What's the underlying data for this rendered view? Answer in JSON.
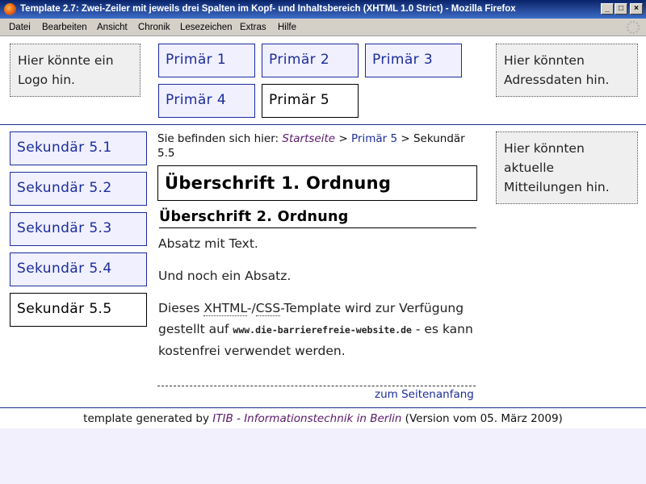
{
  "window": {
    "title": "Template 2.7: Zwei-Zeiler mit jeweils drei Spalten im Kopf- und Inhaltsbereich (XHTML 1.0 Strict) - Mozilla Firefox",
    "controls": {
      "minimize": "_",
      "maximize": "□",
      "close": "×"
    }
  },
  "menu": {
    "items": [
      {
        "label": "Datei"
      },
      {
        "label": "Bearbeiten"
      },
      {
        "label": "Ansicht"
      },
      {
        "label": "Chronik"
      },
      {
        "label": "Lesezeichen"
      },
      {
        "label": "Extras"
      },
      {
        "label": "Hilfe"
      }
    ]
  },
  "header": {
    "logo_text": "Hier könnte ein Logo hin.",
    "address_text": "Hier könnten Adressdaten hin.",
    "primary_nav": [
      {
        "label": "Primär 1"
      },
      {
        "label": "Primär 2"
      },
      {
        "label": "Primär 3"
      },
      {
        "label": "Primär 4"
      },
      {
        "label": "Primär 5",
        "active": true
      }
    ]
  },
  "sidebar": {
    "secondary_nav": [
      {
        "label": "Sekundär 5.1"
      },
      {
        "label": "Sekundär 5.2"
      },
      {
        "label": "Sekundär 5.3"
      },
      {
        "label": "Sekundär 5.4"
      },
      {
        "label": "Sekundär 5.5",
        "active": true
      }
    ]
  },
  "breadcrumb": {
    "prefix": "Sie befinden sich hier:",
    "home": "Startseite",
    "sep1": ">",
    "level1": "Primär 5",
    "sep2": ">",
    "current": "Sekundär 5.5"
  },
  "content": {
    "h1": "Überschrift 1. Ordnung",
    "h2": "Überschrift 2. Ordnung",
    "p1": "Absatz mit Text.",
    "p2": "Und noch ein Absatz.",
    "p3_part1": "Dieses ",
    "p3_abbr1": "XHTML",
    "p3_part2": "-/",
    "p3_abbr2": "CSS",
    "p3_part3": "-Template wird zur Verfügung gestellt auf ",
    "p3_url": "www.die-barrierefreie-website.de",
    "p3_part4": " - es kann kostenfrei verwendet werden.",
    "top_link": "zum Seitenanfang"
  },
  "news": {
    "text": "Hier könnten aktuelle Mitteilungen hin."
  },
  "footer": {
    "prefix": "template generated by ",
    "link": "ITIB - Informationstechnik in Berlin",
    "suffix": " (Version vom 05. März 2009)"
  }
}
